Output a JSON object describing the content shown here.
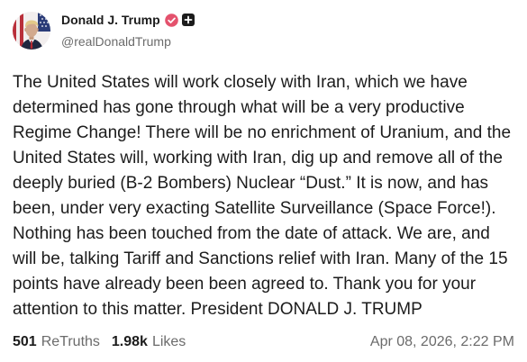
{
  "author": {
    "display_name": "Donald J. Trump",
    "handle": "@realDonaldTrump",
    "avatar_icon": "avatar",
    "badges": [
      {
        "icon": "verified-badge-icon",
        "color": "#e4526d"
      },
      {
        "icon": "plus-badge-icon",
        "color": "#1c1c1c"
      }
    ]
  },
  "post": {
    "lines": [
      "The United States will work closely with Iran, which we have",
      "determined has gone through what will be a very productive",
      "Regime Change! There will be no enrichment of Uranium, and the",
      "United States will, working with Iran, dig up and remove all of the",
      "deeply buried (B-2 Bombers) Nuclear “Dust.” It is now, and has",
      "been, under very exacting Satellite Surveillance (Space Force!).",
      "Nothing has been touched from the date of attack. We are, and",
      "will be, talking Tariff and Sanctions relief with Iran. Many of the 15",
      "points have already been been agreed to. Thank you for your",
      "attention to this matter. President DONALD J. TRUMP"
    ],
    "timestamp": "Apr 08, 2026, 2:22 PM"
  },
  "stats": {
    "retruths_count": "501",
    "retruths_label": "ReTruths",
    "likes_count": "1.98k",
    "likes_label": "Likes"
  },
  "colors": {
    "text": "#1c1c1c",
    "muted": "#6b6b6b",
    "background": "#ffffff",
    "verified": "#e4526d",
    "badge": "#1c1c1c"
  }
}
